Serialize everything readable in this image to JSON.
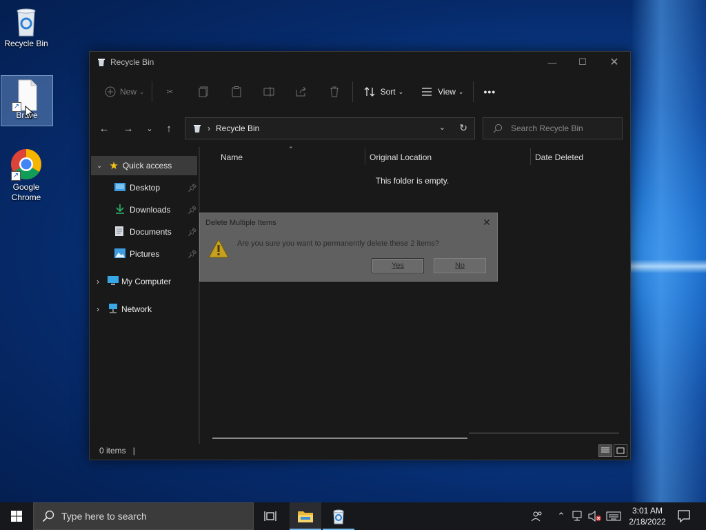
{
  "desktop": {
    "icons": [
      {
        "label": "Recycle Bin"
      },
      {
        "label": "Brave"
      },
      {
        "label": "Google Chrome"
      }
    ]
  },
  "explorer": {
    "title": "Recycle Bin",
    "toolbar": {
      "new_label": "New",
      "sort_label": "Sort",
      "view_label": "View",
      "more_label": "•••"
    },
    "address": {
      "crumb": "Recycle Bin"
    },
    "search": {
      "placeholder": "Search Recycle Bin"
    },
    "sidebar": {
      "items": [
        {
          "label": "Quick access"
        },
        {
          "label": "Desktop"
        },
        {
          "label": "Downloads"
        },
        {
          "label": "Documents"
        },
        {
          "label": "Pictures"
        },
        {
          "label": "My Computer"
        },
        {
          "label": "Network"
        }
      ]
    },
    "columns": [
      "Name",
      "Original Location",
      "Date Deleted"
    ],
    "empty_message": "This folder is empty.",
    "status": {
      "items_count": "0 items"
    }
  },
  "dialog": {
    "title": "Delete Multiple Items",
    "message": "Are you sure you want to permanently delete these 2 items?",
    "yes_label": "Yes",
    "no_label": "No"
  },
  "taskbar": {
    "search_placeholder": "Type here to search",
    "time": "3:01 AM",
    "date": "2/18/2022"
  }
}
